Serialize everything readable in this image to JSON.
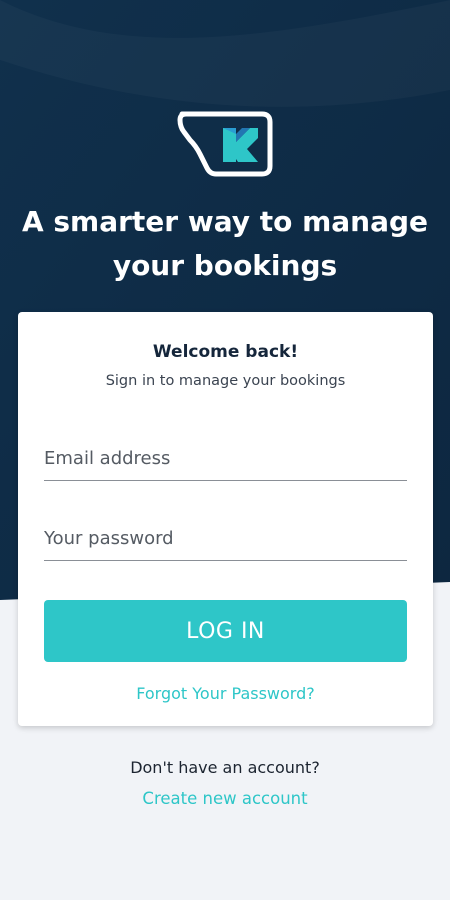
{
  "brand": {
    "logo_icon": "brand-logo-icon",
    "headline_line1": "A smarter way to manage",
    "headline_line2": "your bookings"
  },
  "login_card": {
    "title": "Welcome back!",
    "subtitle": "Sign in to manage your bookings",
    "email": {
      "placeholder": "Email address",
      "value": ""
    },
    "password": {
      "placeholder": "Your password",
      "value": ""
    },
    "login_label": "LOG IN",
    "forgot_label": "Forgot Your Password?"
  },
  "signup": {
    "prompt": "Don't have an account?",
    "link_label": "Create new account"
  },
  "colors": {
    "navy": "#0f2a44",
    "accent": "#2ec6c8",
    "background": "#f1f3f7"
  }
}
